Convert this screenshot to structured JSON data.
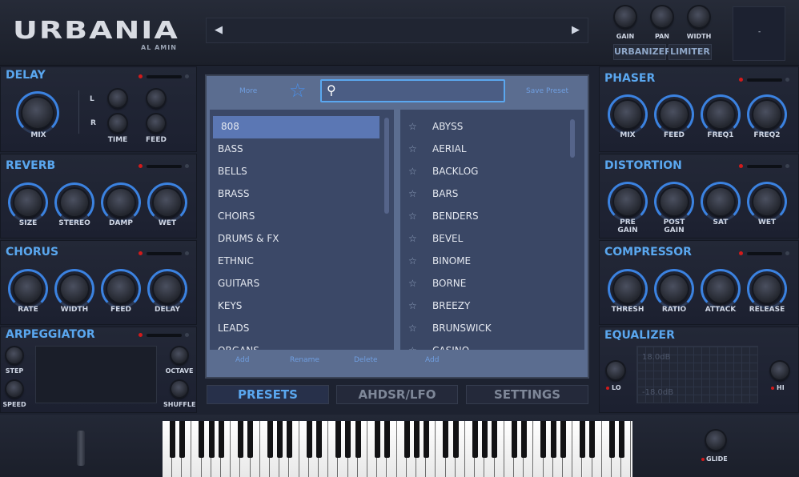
{
  "header": {
    "logo": "URBANIA",
    "author": "AL AMIN",
    "nav_prev": "◀",
    "nav_next": "▶",
    "top_knobs": [
      "GAIN",
      "PAN",
      "WIDTH"
    ],
    "buttons": [
      "URBANIZER",
      "LIMITER"
    ],
    "screen_value": "-"
  },
  "delay": {
    "title": "DELAY",
    "mix": "MIX",
    "l": "L",
    "r": "R",
    "time": "TIME",
    "feed": "FEED"
  },
  "reverb": {
    "title": "REVERB",
    "knobs": [
      "SIZE",
      "STEREO",
      "DAMP",
      "WET"
    ]
  },
  "chorus": {
    "title": "CHORUS",
    "knobs": [
      "RATE",
      "WIDTH",
      "FEED",
      "DELAY"
    ]
  },
  "arpeggiator": {
    "title": "ARPEGGIATOR",
    "step": "STEP",
    "speed": "SPEED",
    "octave": "OCTAVE",
    "shuffle": "SHUFFLE"
  },
  "phaser": {
    "title": "PHASER",
    "knobs": [
      "MIX",
      "FEED",
      "FREQ1",
      "FREQ2"
    ]
  },
  "distortion": {
    "title": "DISTORTION",
    "knobs": [
      "PRE\nGAIN",
      "POST\nGAIN",
      "SAT",
      "WET"
    ]
  },
  "compressor": {
    "title": "COMPRESSOR",
    "knobs": [
      "THRESH",
      "RATIO",
      "ATTACK",
      "RELEASE"
    ]
  },
  "equalizer": {
    "title": "EQUALIZER",
    "top_db": "18.0dB",
    "bot_db": "-18.0dB",
    "lo": "LO",
    "hi": "HI"
  },
  "browser": {
    "more": "More",
    "save_preset": "Save Preset",
    "search_placeholder": "",
    "categories": [
      "808",
      "BASS",
      "BELLS",
      "BRASS",
      "CHOIRS",
      "DRUMS & FX",
      "ETHNIC",
      "GUITARS",
      "KEYS",
      "LEADS",
      "ORGANS"
    ],
    "presets": [
      "ABYSS",
      "AERIAL",
      "BACKLOG",
      "BARS",
      "BENDERS",
      "BEVEL",
      "BINOME",
      "BORNE",
      "BREEZY",
      "BRUNSWICK",
      "CASINO"
    ],
    "cat_add": "Add",
    "cat_rename": "Rename",
    "cat_delete": "Delete",
    "preset_add": "Add"
  },
  "tabs": [
    "PRESETS",
    "AHDSR/LFO",
    "SETTINGS"
  ],
  "glide": "GLIDE",
  "colors": {
    "accent": "#5aa7ef",
    "led": "#d21b1b",
    "selected": "#5b77b4"
  }
}
